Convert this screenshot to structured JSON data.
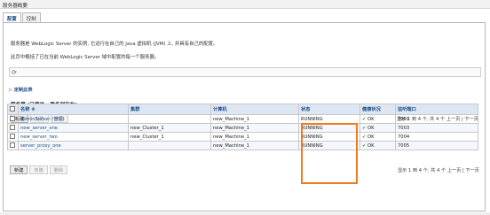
{
  "window": {
    "title": "服务器概要"
  },
  "tabs": [
    {
      "label": "配置",
      "active": true
    },
    {
      "label": "控制",
      "active": false
    }
  ],
  "description": {
    "line1": "服务器是 WebLogic Server 的实例, 它运行在自己的 Java 虚拟机 (JVM) 上, 并具有自己的配置。",
    "line2": "此页中概括了已在当前 WebLogic Server 域中配置的每一个服务器。"
  },
  "refresh_icon": "refresh-icon",
  "customize_link": "▷ 定制此表",
  "table_title": "服务器 (已筛选 - 更多列存在)",
  "buttons": {
    "new": "新建",
    "clone": "克隆",
    "delete": "删除"
  },
  "pager": "显示 1 到 4 个, 共 4 个   上一页 | 下一页",
  "columns": [
    "名称 ⟰",
    "集群",
    "计算机",
    "状态",
    "健康状况",
    "监听端口"
  ],
  "rows": [
    {
      "name": "AdminServer (管理)",
      "cluster": "",
      "machine": "new_Machine_1",
      "state": "RUNNING",
      "health": "OK",
      "port": "7001"
    },
    {
      "name": "new_server_one",
      "cluster": "new_Cluster_1",
      "machine": "new_Machine_1",
      "state": "RUNNING",
      "health": "OK",
      "port": "7003"
    },
    {
      "name": "new_server_two",
      "cluster": "new_Cluster_1",
      "machine": "new_Machine_1",
      "state": "RUNNING",
      "health": "OK",
      "port": "7004"
    },
    {
      "name": "server_proxy_one",
      "cluster": "",
      "machine": "new_Machine_1",
      "state": "RUNNING",
      "health": "OK",
      "port": "7005"
    }
  ],
  "colors": {
    "link": "#1f4f8a",
    "header_bg": "#dde7f3",
    "ok": "#2e9a2e",
    "highlight": "#f07b1c"
  }
}
